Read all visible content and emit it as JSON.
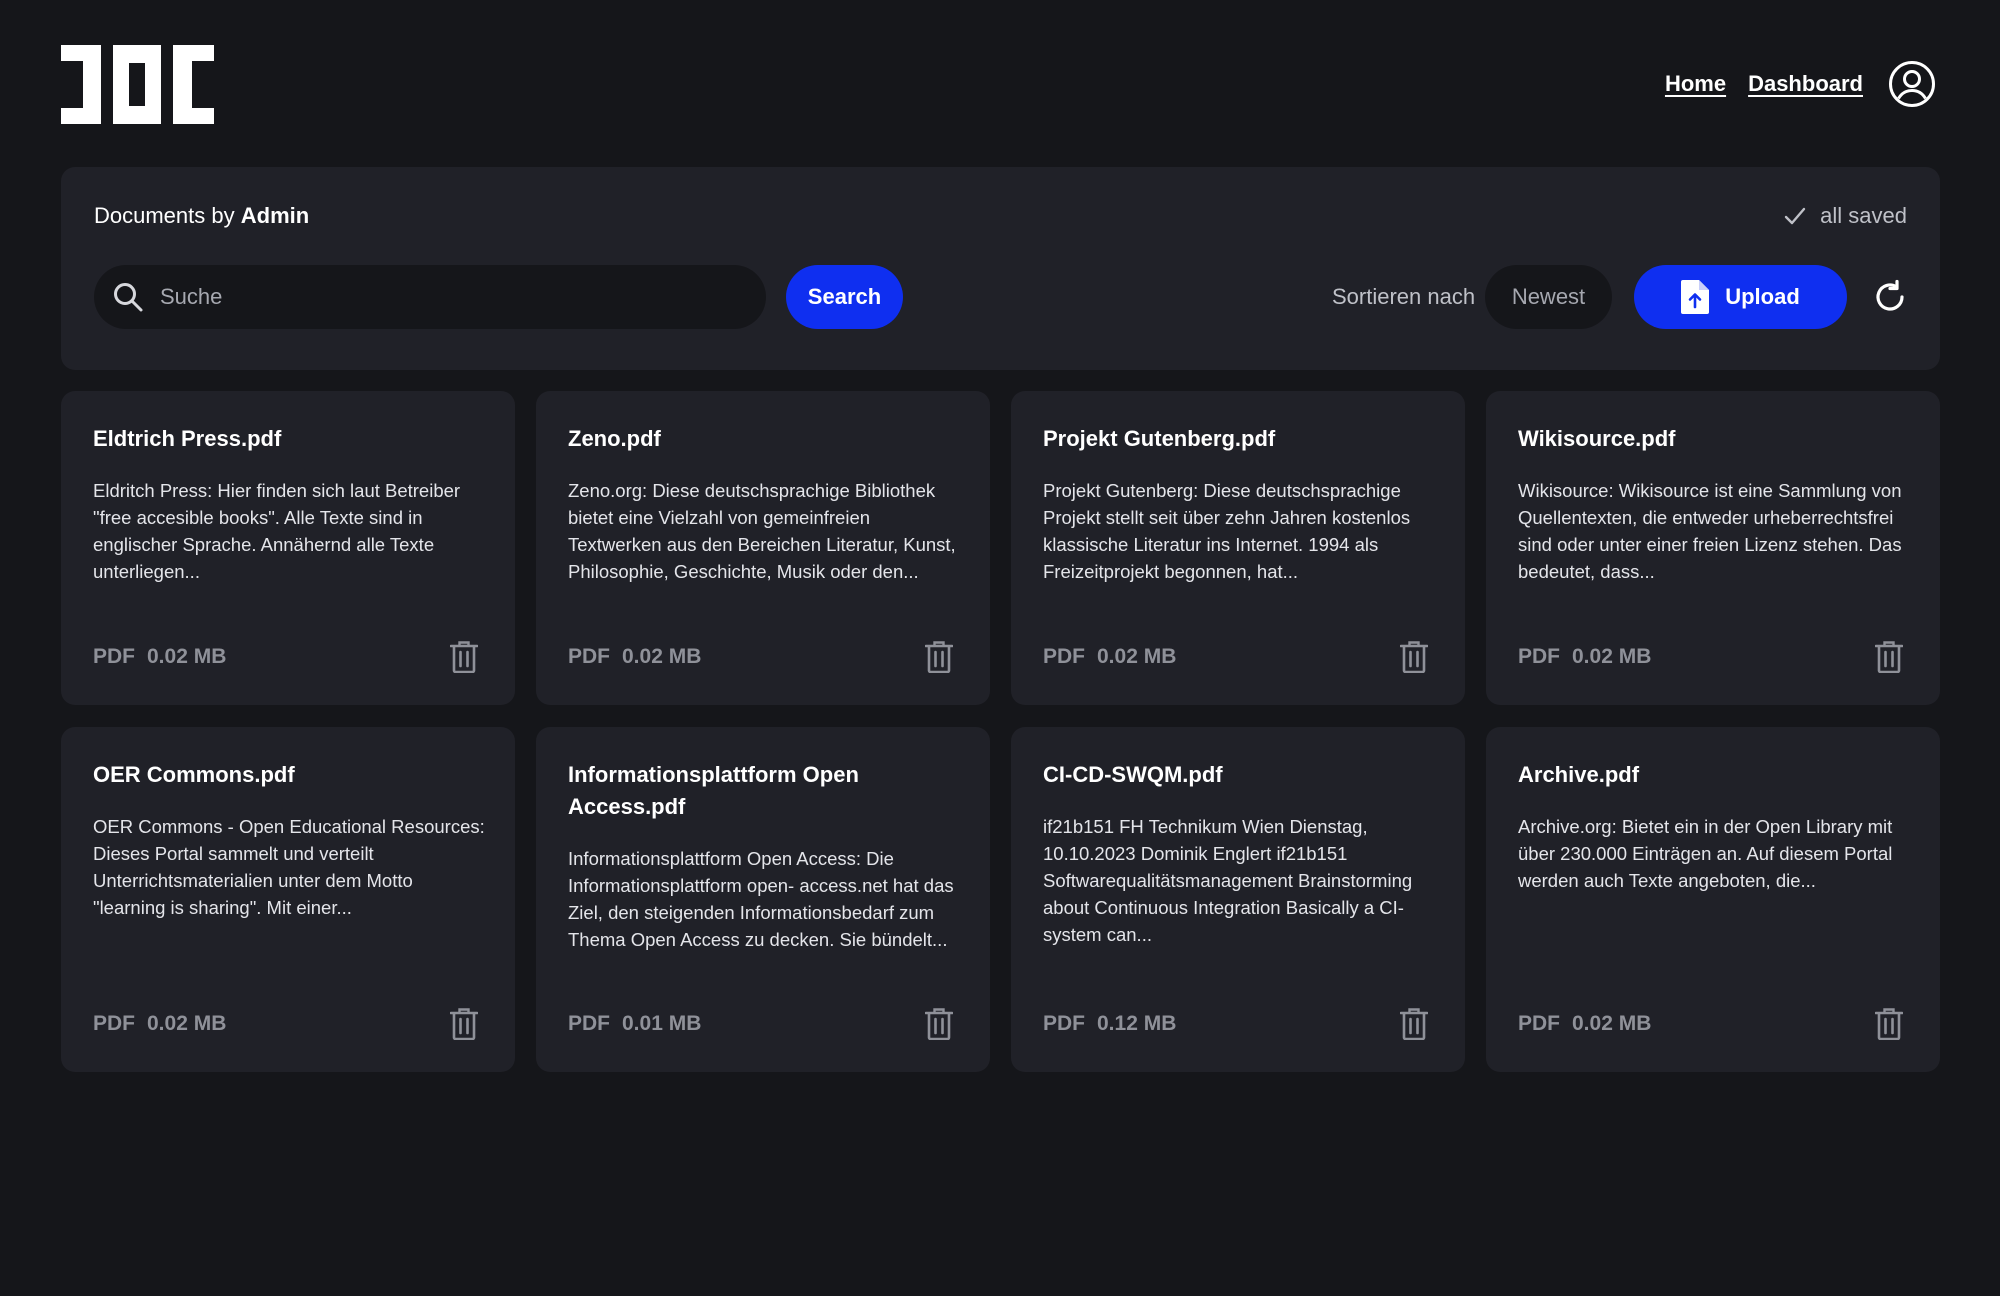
{
  "nav": {
    "home": "Home",
    "dashboard": "Dashboard"
  },
  "toolbar": {
    "title_prefix": "Documents by",
    "owner": "Admin",
    "saved_status": "all saved",
    "search_placeholder": "Suche",
    "search_button": "Search",
    "sort_label": "Sortieren nach",
    "sort_value": "Newest",
    "upload_button": "Upload"
  },
  "colors": {
    "background": "#15161a",
    "panel": "#202128",
    "accent": "#0f2ff0"
  },
  "documents": [
    {
      "title": "Eldtrich Press.pdf",
      "description": "Eldritch Press: Hier finden sich laut Betreiber \"free accesible books\". Alle Texte sind in englischer Sprache. Annähernd alle Texte unterliegen...",
      "type": "PDF",
      "size": "0.02 MB"
    },
    {
      "title": "Zeno.pdf",
      "description": "Zeno.org: Diese deutschsprachige Bibliothek bietet eine Vielzahl von gemeinfreien Textwerken aus den Bereichen Literatur, Kunst, Philosophie, Geschichte, Musik oder den...",
      "type": "PDF",
      "size": "0.02 MB"
    },
    {
      "title": "Projekt Gutenberg.pdf",
      "description": "Projekt Gutenberg: Diese deutschsprachige Projekt stellt seit über zehn Jahren kostenlos klassische Literatur ins Internet. 1994 als Freizeitprojekt begonnen, hat...",
      "type": "PDF",
      "size": "0.02 MB"
    },
    {
      "title": "Wikisource.pdf",
      "description": "Wikisource: Wikisource ist eine Sammlung von Quellentexten, die entweder urheberrechtsfrei sind oder unter einer freien Lizenz stehen. Das bedeutet, dass...",
      "type": "PDF",
      "size": "0.02 MB"
    },
    {
      "title": "OER Commons.pdf",
      "description": "OER Commons - Open Educational Resources: Dieses Portal sammelt und verteilt Unterrichtsmaterialien unter dem Motto \"learning is sharing\". Mit einer...",
      "type": "PDF",
      "size": "0.02 MB"
    },
    {
      "title": "Informationsplattform Open Access.pdf",
      "description": "Informationsplattform Open Access: Die Informationsplattform open- access.net hat das Ziel, den steigenden Informationsbedarf zum Thema Open Access zu decken. Sie bündelt...",
      "type": "PDF",
      "size": "0.01 MB"
    },
    {
      "title": "CI-CD-SWQM.pdf",
      "description": "if21b151 FH Technikum Wien Dienstag, 10.10.2023 Dominik Englert if21b151 Softwarequalitätsmanagement Brainstorming about Continuous Integration Basically a CI- system can...",
      "type": "PDF",
      "size": "0.12 MB"
    },
    {
      "title": "Archive.pdf",
      "description": "Archive.org: Bietet ein in der Open Library mit über 230.000 Einträgen an. Auf diesem Portal werden auch Texte angeboten, die...",
      "type": "PDF",
      "size": "0.02 MB"
    }
  ]
}
